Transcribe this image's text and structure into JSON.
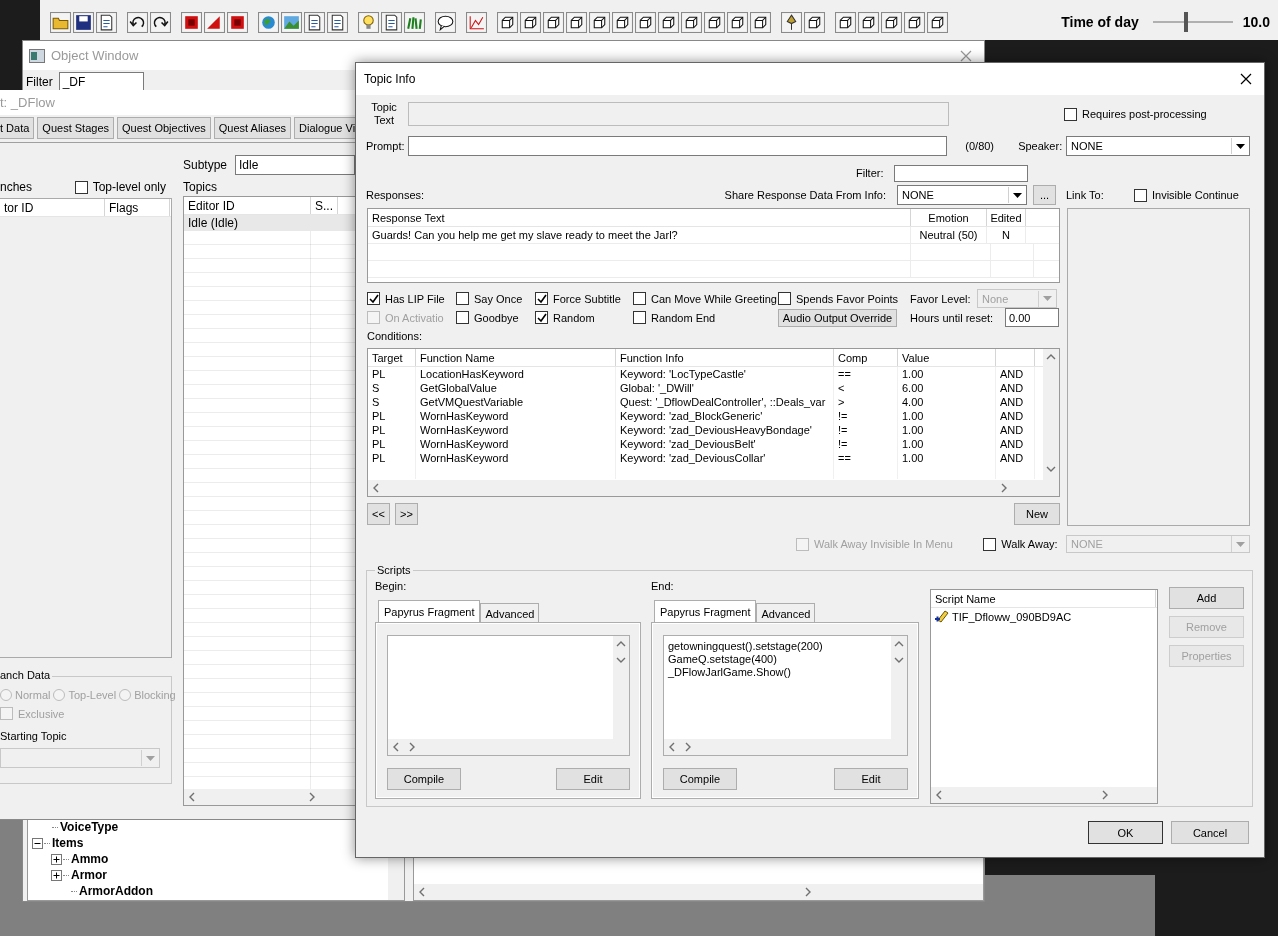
{
  "toolbar": {
    "time_label": "Time of day",
    "time_slider": {
      "level": 0.42
    },
    "time_value": "10.0"
  },
  "object_window": {
    "title": "Object Window",
    "filter_label": "Filter",
    "filter_value": "_DF",
    "tree": [
      {
        "label": "VoiceType"
      },
      {
        "label": "Items",
        "expanded": true,
        "children": [
          {
            "label": "Ammo",
            "expanded": false
          },
          {
            "label": "Armor",
            "expanded": false
          },
          {
            "label": "ArmorAddon"
          }
        ]
      }
    ]
  },
  "quest_window": {
    "title": "t: _DFlow",
    "tabs": [
      {
        "label": "t Data",
        "selected": false
      },
      {
        "label": "Quest Stages",
        "selected": false
      },
      {
        "label": "Quest Objectives",
        "selected": false
      },
      {
        "label": "Quest Aliases",
        "selected": false
      },
      {
        "label": "Dialogue Vi",
        "selected": false
      }
    ],
    "branches_label": "nches",
    "top_level_only": {
      "label": "Top-level only",
      "checked": false
    },
    "branch_columns": [
      "tor ID",
      "Flags"
    ],
    "subtype_label": "Subtype",
    "subtype_value": "Idle",
    "topics_label": "Topics",
    "topic_columns": [
      "Editor ID",
      "S..."
    ],
    "topic_rows": [
      {
        "editor_id": "Idle (Idle)",
        "selected": true
      }
    ],
    "branch_data": {
      "title": "anch Data",
      "radios": [
        {
          "label": "Normal",
          "selected": false,
          "disabled": true
        },
        {
          "label": "Top-Level",
          "selected": false,
          "disabled": true
        },
        {
          "label": "Blocking",
          "selected": false,
          "disabled": true
        }
      ],
      "exclusive": {
        "label": "Exclusive",
        "checked": false,
        "disabled": true
      },
      "starting_topic_label": "Starting Topic"
    }
  },
  "topic_info": {
    "title": "Topic Info",
    "topic_text_label": "Topic Text",
    "requires_post_processing": {
      "label": "Requires post-processing",
      "checked": false
    },
    "prompt_label": "Prompt:",
    "prompt_count": "(0/80)",
    "speaker_label": "Speaker:",
    "speaker_value": "NONE",
    "filter_label": "Filter:",
    "responses_label": "Responses:",
    "share_label": "Share Response Data From Info:",
    "share_value": "NONE",
    "share_button": "...",
    "link_to_label": "Link To:",
    "invisible_continue": {
      "label": "Invisible Continue",
      "checked": false
    },
    "response_columns": [
      "Response Text",
      "Emotion",
      "Edited"
    ],
    "responses": [
      {
        "text": "Guards! Can you help me get my slave ready to meet the Jarl?",
        "emotion": "Neutral (50)",
        "edited": "N"
      }
    ],
    "flags": [
      {
        "label": "Has LIP File",
        "checked": true,
        "disabled": false
      },
      {
        "label": "Say Once",
        "checked": false,
        "disabled": false
      },
      {
        "label": "Force Subtitle",
        "checked": true,
        "disabled": false
      },
      {
        "label": "Can Move While Greeting",
        "checked": false,
        "disabled": false
      },
      {
        "label": "Spends Favor Points",
        "checked": false,
        "disabled": false
      },
      {
        "label": "On Activatio",
        "checked": false,
        "disabled": true
      },
      {
        "label": "Goodbye",
        "checked": false,
        "disabled": false
      },
      {
        "label": "Random",
        "checked": true,
        "disabled": false
      },
      {
        "label": "Random End",
        "checked": false,
        "disabled": false
      }
    ],
    "audio_button": "Audio Output Override",
    "favor_level_label": "Favor Level:",
    "favor_level_value": "None",
    "hours_label": "Hours until reset:",
    "hours_value": "0.00",
    "conditions_label": "Conditions:",
    "condition_columns": [
      "Target",
      "Function Name",
      "Function Info",
      "Comp",
      "Value"
    ],
    "conditions": [
      {
        "target": "PL",
        "function_name": "LocationHasKeyword",
        "function_info": "Keyword: 'LocTypeCastle'",
        "comp": "==",
        "value": "1.00",
        "column_6": "AND"
      },
      {
        "target": "S",
        "function_name": "GetGlobalValue",
        "function_info": "Global: '_DWill'",
        "comp": "<",
        "value": "6.00",
        "column_6": "AND"
      },
      {
        "target": "S",
        "function_name": "GetVMQuestVariable",
        "function_info": "Quest: '_DflowDealController', ::Deals_var",
        "comp": ">",
        "value": "4.00",
        "column_6": "AND"
      },
      {
        "target": "PL",
        "function_name": "WornHasKeyword",
        "function_info": "Keyword: 'zad_BlockGeneric'",
        "comp": "!=",
        "value": "1.00",
        "column_6": "AND"
      },
      {
        "target": "PL",
        "function_name": "WornHasKeyword",
        "function_info": "Keyword: 'zad_DeviousHeavyBondage'",
        "comp": "!=",
        "value": "1.00",
        "column_6": "AND"
      },
      {
        "target": "PL",
        "function_name": "WornHasKeyword",
        "function_info": "Keyword: 'zad_DeviousBelt'",
        "comp": "!=",
        "value": "1.00",
        "column_6": "AND"
      },
      {
        "target": "PL",
        "function_name": "WornHasKeyword",
        "function_info": "Keyword: 'zad_DeviousCollar'",
        "comp": "==",
        "value": "1.00",
        "column_6": "AND"
      }
    ],
    "prev_button": "<<",
    "next_button": ">>",
    "new_button": "New",
    "walk_away_invisible": {
      "label": "Walk Away Invisible In Menu",
      "checked": false,
      "disabled": true
    },
    "walk_away": {
      "label": "Walk Away:",
      "checked": false,
      "disabled": false
    },
    "walk_away_value": "NONE",
    "scripts": {
      "title": "Scripts",
      "panels": [
        {
          "label": "Begin:",
          "tabs": [
            {
              "label": "Papyrus Fragment",
              "selected": true
            },
            {
              "label": "Advanced",
              "selected": false
            }
          ],
          "buttons": [
            "Compile",
            "Edit"
          ]
        },
        {
          "label": "End:",
          "tabs": [
            {
              "label": "Papyrus Fragment",
              "selected": true
            },
            {
              "label": "Advanced",
              "selected": false
            }
          ],
          "code_lines": [
            "getowningquest().setstage(200)",
            "GameQ.setstage(400)",
            "_DFlowJarlGame.Show()"
          ],
          "buttons": [
            "Compile",
            "Edit"
          ]
        }
      ],
      "list_header": "Script Name",
      "items": [
        "TIF_Dfloww_090BD9AC"
      ],
      "buttons": [
        {
          "label": "Add",
          "disabled": false
        },
        {
          "label": "Remove",
          "disabled": true
        },
        {
          "label": "Properties",
          "disabled": true
        }
      ]
    },
    "ok_button": "OK",
    "cancel_button": "Cancel"
  }
}
